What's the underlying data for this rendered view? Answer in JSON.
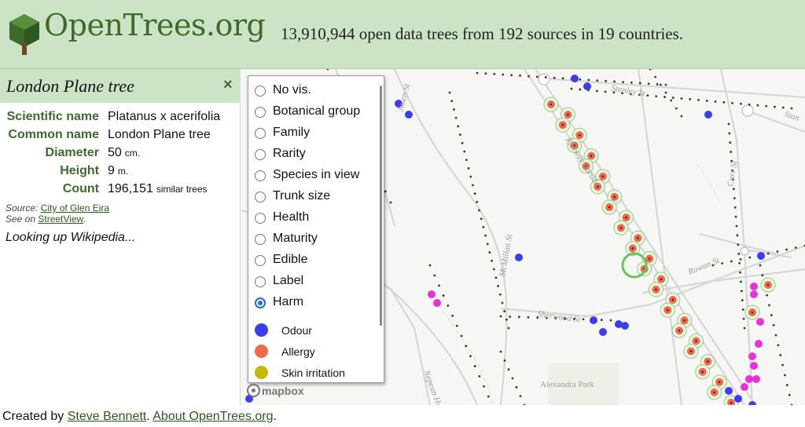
{
  "header": {
    "site_title": "OpenTrees.org",
    "tagline": "13,910,944 open data trees from 192 sources in 19 countries.",
    "logo_icon": "tree-icon"
  },
  "panel": {
    "title": "London Plane tree",
    "close_label": "×",
    "properties": [
      {
        "label": "Scientific name",
        "value": "Platanus x acerifolia",
        "unit": ""
      },
      {
        "label": "Common name",
        "value": "London Plane tree",
        "unit": ""
      },
      {
        "label": "Diameter",
        "value": "50",
        "unit": "cm."
      },
      {
        "label": "Height",
        "value": "9",
        "unit": "m."
      },
      {
        "label": "Count",
        "value": "196,151",
        "unit": "similar trees"
      }
    ],
    "source_prefix": "Source: ",
    "source_link": "City of Glen Eira",
    "streetview_prefix": "See on ",
    "streetview_link": "StreetView",
    "streetview_suffix": ".",
    "wiki_status": "Looking up Wikipedia..."
  },
  "layer_menu": {
    "options": [
      {
        "label": "No vis.",
        "checked": false
      },
      {
        "label": "Botanical group",
        "checked": false
      },
      {
        "label": "Family",
        "checked": false
      },
      {
        "label": "Rarity",
        "checked": false
      },
      {
        "label": "Species in view",
        "checked": false
      },
      {
        "label": "Trunk size",
        "checked": false
      },
      {
        "label": "Health",
        "checked": false
      },
      {
        "label": "Maturity",
        "checked": false
      },
      {
        "label": "Edible",
        "checked": false
      },
      {
        "label": "Label",
        "checked": false
      },
      {
        "label": "Harm",
        "checked": true
      }
    ],
    "legend": [
      {
        "label": "Odour",
        "color": "#3c3cf0"
      },
      {
        "label": "Allergy",
        "color": "#ee6a4c"
      },
      {
        "label": "Skin irritation",
        "color": "#c7b90b"
      }
    ]
  },
  "map": {
    "streets": {
      "stanley": "Stanley St",
      "stan_short": "Stan",
      "jasen": "Jasen St",
      "railway": "Railway Parade",
      "carrst": "Carr St",
      "rowan": "Rowan St",
      "mcmillan": "McMillan St",
      "sherwood": "Sherwood St",
      "nepean": "Nepean Hwy",
      "alexandra": "Alexandra Park"
    },
    "mapbox_label": "mapbox",
    "colors": {
      "odour": "#3c3cf0",
      "allergy": "#ee6a4c",
      "other": "#e632d8",
      "tree": "#3a3a20"
    }
  },
  "footer": {
    "created_prefix": "Created by ",
    "author": "Steve Bennett",
    "separator": ". ",
    "about_link": "About OpenTrees.org",
    "suffix": "."
  }
}
